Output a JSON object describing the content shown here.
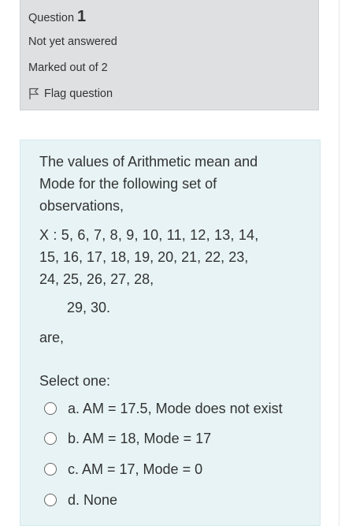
{
  "question_info": {
    "label": "Question",
    "number": "1",
    "state": "Not yet answered",
    "grade": "Marked out of 2",
    "flag_label": "Flag question"
  },
  "question": {
    "text_lines": [
      "The values of Arithmetic mean and",
      "Mode for the following set of",
      "observations,"
    ],
    "data_lines": [
      "X : 5, 6, 7, 8, 9, 10, 11, 12, 13, 14,",
      "15, 16, 17, 18, 19, 20, 21, 22, 23,",
      "24, 25, 26, 27, 28,",
      "29, 30."
    ],
    "ending": "are,",
    "prompt": "Select one:"
  },
  "options": [
    {
      "label": "a. AM = 17.5, Mode does not exist"
    },
    {
      "label": "b. AM = 18, Mode = 17"
    },
    {
      "label": "c. AM = 17, Mode = 0"
    },
    {
      "label": "d. None"
    }
  ],
  "colors": {
    "info_background": "#dfe0e2",
    "content_background": "#e7f3f5"
  }
}
